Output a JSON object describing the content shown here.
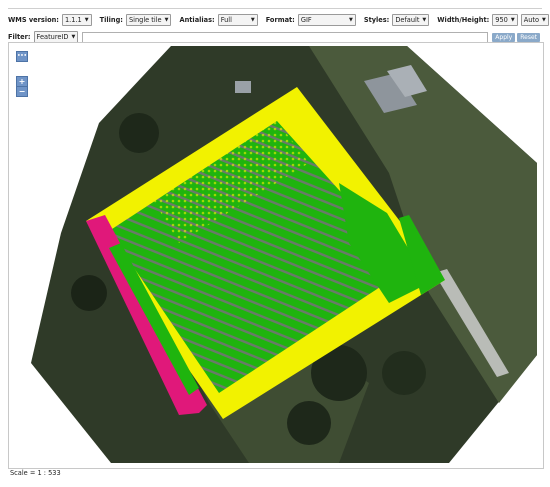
{
  "toolbar": {
    "wms_version_label": "WMS version:",
    "wms_version_value": "1.1.1",
    "tiling_label": "Tiling:",
    "tiling_value": "Single tile",
    "antialias_label": "Antialias:",
    "antialias_value": "Full",
    "format_label": "Format:",
    "format_value": "GIF",
    "styles_label": "Styles:",
    "styles_value": "Default",
    "size_label": "Width/Height:",
    "width_value": "950",
    "height_value": "Auto"
  },
  "filter": {
    "label": "Filter:",
    "type_value": "FeatureID",
    "input_value": "",
    "apply_label": "Apply",
    "reset_label": "Reset"
  },
  "map": {
    "zoom_in": "+",
    "zoom_out": "−",
    "tools": "•••",
    "colors": {
      "yellow": "#f2f200",
      "green": "#1fb40e",
      "magenta": "#e0187a",
      "gray": "#6a7a6a"
    }
  },
  "scale": {
    "text": "Scale = 1 : 533"
  }
}
